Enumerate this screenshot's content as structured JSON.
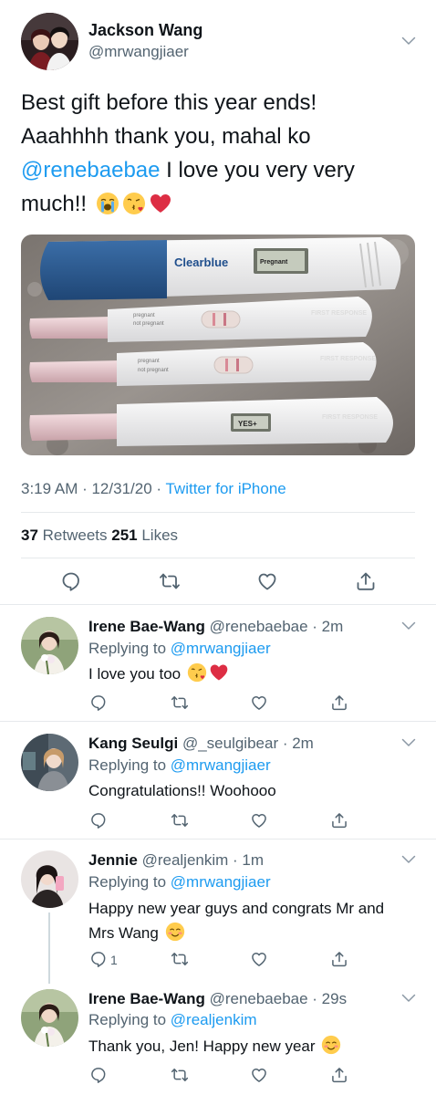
{
  "main_tweet": {
    "name": "Jackson Wang",
    "handle": "@mrwangjiaer",
    "text_line1": "Best gift before this year ends!",
    "text_line2": "Aaahhhh thank you, mahal ko",
    "mention": "@renebaebae",
    "text_line3_rest": " I love you very very",
    "text_line4": "much!!",
    "time": "3:19 AM · 12/31/20 · ",
    "source": "Twitter for iPhone",
    "retweets_count": "37",
    "retweets_label": " Retweets ",
    "likes_count": "251",
    "likes_label": " Likes",
    "photo_texts": {
      "brand": "Clearblue",
      "screen1": "Pregnant",
      "label_pregnant": "pregnant",
      "label_not_pregnant": "not pregnant",
      "yes": "YES+",
      "fr": "FIRST RESPONSE"
    }
  },
  "replies": [
    {
      "name": "Irene Bae-Wang",
      "handle_time": " @renebaebae · 2m",
      "replying_prefix": "Replying to ",
      "replying_to": "@mrwangjiaer",
      "text": "I love you too",
      "reply_count": ""
    },
    {
      "name": "Kang Seulgi",
      "handle_time": " @_seulgibear · 2m",
      "replying_prefix": "Replying to ",
      "replying_to": "@mrwangjiaer",
      "text": "Congratulations!! Woohooo",
      "reply_count": ""
    },
    {
      "name": "Jennie",
      "handle_time": " @realjenkim · 1m",
      "replying_prefix": "Replying to ",
      "replying_to": "@mrwangjiaer",
      "text_line1": "Happy new year guys and congrats Mr and",
      "text_line2": "Mrs Wang",
      "reply_count": "1"
    },
    {
      "name": "Irene Bae-Wang",
      "handle_time": " @renebaebae · 29s",
      "replying_prefix": "Replying to ",
      "replying_to": "@realjenkim",
      "text": "Thank you, Jen! Happy new year",
      "reply_count": ""
    }
  ],
  "icons": {
    "reply": "reply-icon",
    "retweet": "retweet-icon",
    "like": "heart-icon",
    "share": "share-icon",
    "more": "chevron-down-icon"
  },
  "colors": {
    "link": "#1d9bf0",
    "secondary": "#536471",
    "text": "#0f1419",
    "divider": "#e6e9ec"
  }
}
